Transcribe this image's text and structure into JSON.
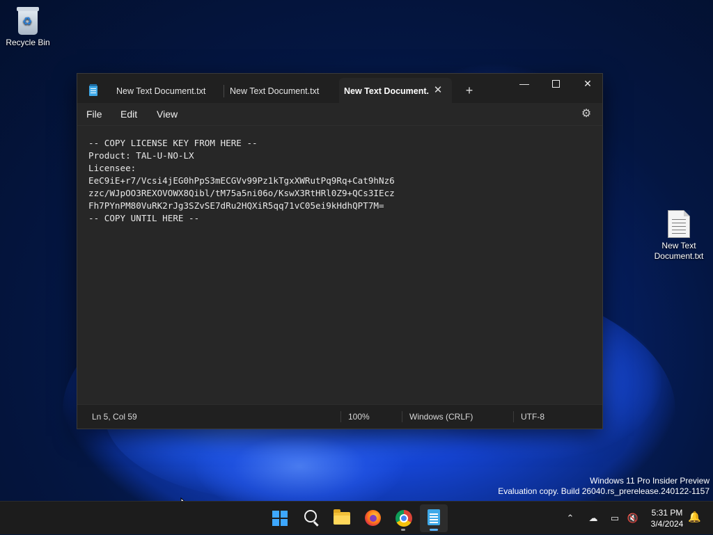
{
  "desktop": {
    "recycle_bin_label": "Recycle Bin",
    "text_file_label": "New Text Document.txt"
  },
  "notepad": {
    "tabs": [
      {
        "label": "New Text Document.txt"
      },
      {
        "label": "New Text Document.txt"
      },
      {
        "label": "New Text Document."
      }
    ],
    "menu": {
      "file": "File",
      "edit": "Edit",
      "view": "View"
    },
    "content": "-- COPY LICENSE KEY FROM HERE --\nProduct: TAL-U-NO-LX\nLicensee:\nEeC9iE+r7/Vcsi4jEG0hPpS3mECGVv99Pz1kTgxXWRutPq9Rq+Cat9hNz6\nzzc/WJpOO3REXOVOWX8Qibl/tM75a5ni06o/KswX3RtHRl0Z9+QCs3IEcz\nFh7PYnPM80VuRK2rJg3SZvSE7dRu2HQXiR5qq71vC05ei9kHdhQPT7M=\n-- COPY UNTIL HERE --",
    "status": {
      "position": "Ln 5, Col 59",
      "zoom": "100%",
      "line_ending": "Windows (CRLF)",
      "encoding": "UTF-8"
    }
  },
  "watermark": {
    "line1": "Windows 11 Pro Insider Preview",
    "line2": "Evaluation copy. Build 26040.rs_prerelease.240122-1157"
  },
  "taskbar": {
    "apps": [
      "start",
      "search",
      "file-explorer",
      "firefox",
      "chrome",
      "notepad"
    ],
    "time": "5:31 PM",
    "date": "3/4/2024"
  },
  "colors": {
    "accent": "#3da7ff",
    "window_bg": "#272727",
    "titlebar_bg": "#202020"
  }
}
